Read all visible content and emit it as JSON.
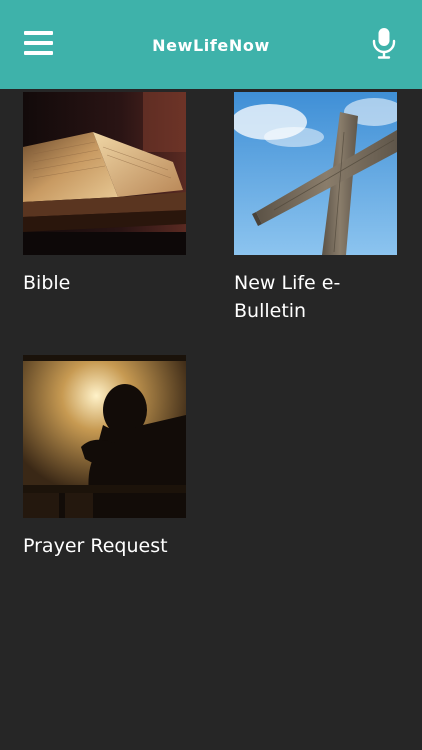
{
  "header": {
    "title": "NewLifeNow",
    "background_color": "#3eb2aa",
    "menu_icon": "hamburger-menu-icon",
    "mic_icon": "microphone-icon"
  },
  "tiles": [
    {
      "label": "Bible",
      "image": "open-bible-photo"
    },
    {
      "label": "New Life e-Bulletin",
      "image": "wooden-cross-sky-photo"
    },
    {
      "label": "Prayer Request",
      "image": "praying-silhouette-photo"
    }
  ],
  "colors": {
    "background": "#262626",
    "text": "#ffffff"
  }
}
